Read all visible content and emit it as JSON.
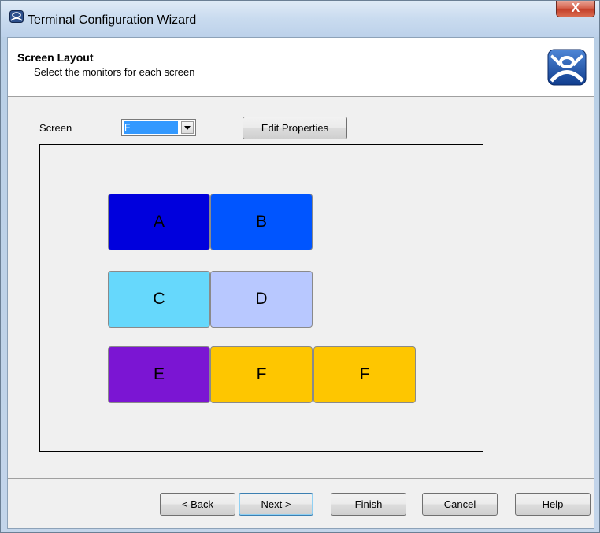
{
  "window": {
    "title": "Terminal Configuration Wizard",
    "close_glyph": "X"
  },
  "header": {
    "title": "Screen Layout",
    "subtitle": "Select the monitors for each screen",
    "logo_icon": "thinmanager-logo-icon"
  },
  "screen_selector": {
    "label": "Screen",
    "selected_value": "F"
  },
  "edit_properties_label": "Edit Properties",
  "monitors": [
    {
      "label": "A",
      "color": "#0000dd"
    },
    {
      "label": "B",
      "color": "#0055ff"
    },
    {
      "label": "C",
      "color": "#66d8fc"
    },
    {
      "label": "D",
      "color": "#b8c8ff"
    },
    {
      "label": "E",
      "color": "#7b15d3"
    },
    {
      "label": "F",
      "color": "#fec600"
    },
    {
      "label": "F",
      "color": "#fec600"
    }
  ],
  "buttons": {
    "back": "< Back",
    "next": "Next >",
    "finish": "Finish",
    "cancel": "Cancel",
    "help": "Help"
  }
}
